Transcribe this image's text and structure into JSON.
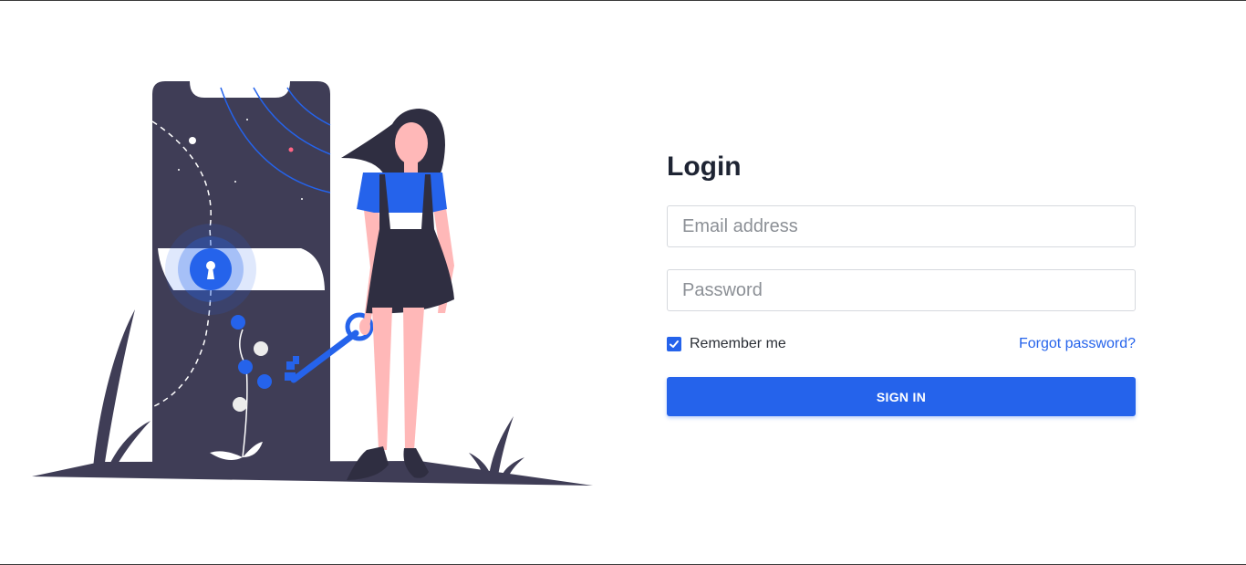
{
  "login": {
    "title": "Login",
    "email_placeholder": "Email address",
    "password_placeholder": "Password",
    "remember_label": "Remember me",
    "remember_checked": true,
    "forgot_label": "Forgot password?",
    "sign_in_label": "SIGN IN"
  },
  "colors": {
    "accent": "#2563eb",
    "dark": "#3f3d56",
    "skin": "#ffb8b8"
  },
  "icons": {
    "illustration": "secure-login-illustration",
    "checkbox": "check-icon"
  }
}
